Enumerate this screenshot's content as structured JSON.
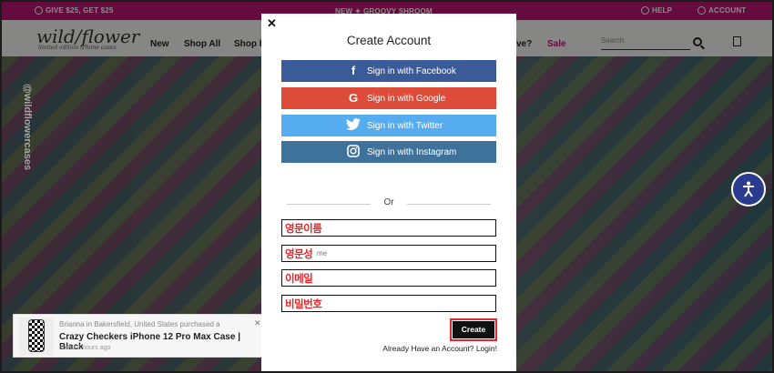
{
  "promo": {
    "left": "GIVE $25, GET $25",
    "center": "NEW ✦ GROOVY SHROOM",
    "help": "HELP",
    "account": "ACCOUNT"
  },
  "header": {
    "logo": "wild/flower",
    "logo_sub": "limited edition iPhone cases",
    "nav": [
      "New",
      "Shop All",
      "Shop b",
      "ve?",
      "Sale"
    ],
    "search_placeholder": "Search"
  },
  "background": {
    "watermark": "@wildflowercases"
  },
  "notification": {
    "line1": "Brianna in Bakersfield, United States purchased a",
    "product": "Crazy Checkers iPhone 12 Pro Max Case | Black",
    "time": "about 2 hours ago"
  },
  "modal": {
    "close": "✕",
    "title": "Create Account",
    "social": {
      "facebook": "Sign in with Facebook",
      "google": "Sign in with Google",
      "twitter": "Sign in with Twitter",
      "instagram": "Sign in with Instagram"
    },
    "or": "Or",
    "fields": {
      "first_name_overlay": "영문이름",
      "last_name_overlay": "영문성",
      "last_name_placeholder": "me",
      "email_overlay": "이메일",
      "password_overlay": "비밀번호"
    },
    "create_button": "Create",
    "login_text": "Already Have an Account? Login!"
  },
  "colors": {
    "promo_bar": "#b8156f",
    "facebook": "#3b5b98",
    "google": "#dd4b39",
    "twitter": "#55acee",
    "instagram": "#3f729b",
    "annotation_red": "#e8262a"
  }
}
